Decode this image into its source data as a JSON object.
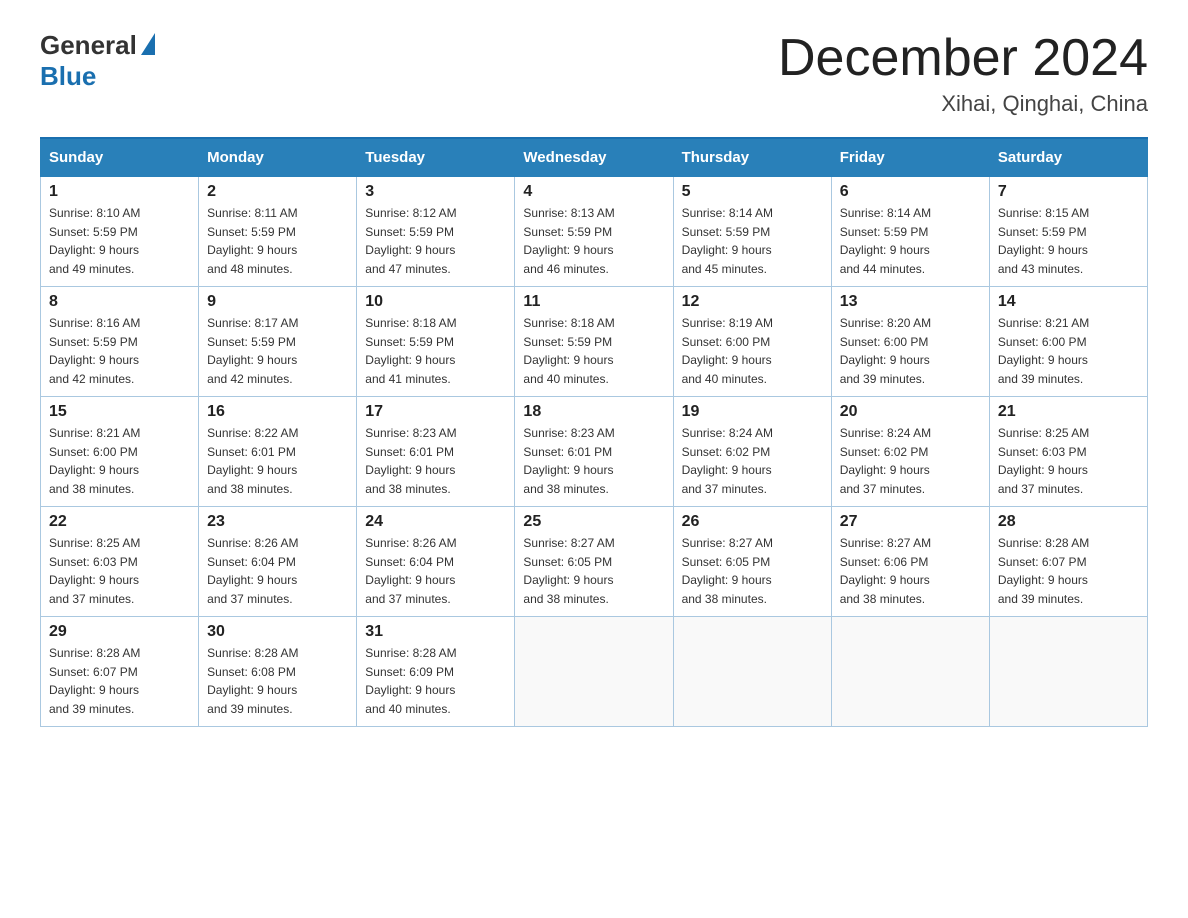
{
  "header": {
    "logo_general": "General",
    "logo_blue": "Blue",
    "title": "December 2024",
    "subtitle": "Xihai, Qinghai, China"
  },
  "days_of_week": [
    "Sunday",
    "Monday",
    "Tuesday",
    "Wednesday",
    "Thursday",
    "Friday",
    "Saturday"
  ],
  "weeks": [
    [
      {
        "day": "1",
        "sunrise": "8:10 AM",
        "sunset": "5:59 PM",
        "daylight": "9 hours and 49 minutes."
      },
      {
        "day": "2",
        "sunrise": "8:11 AM",
        "sunset": "5:59 PM",
        "daylight": "9 hours and 48 minutes."
      },
      {
        "day": "3",
        "sunrise": "8:12 AM",
        "sunset": "5:59 PM",
        "daylight": "9 hours and 47 minutes."
      },
      {
        "day": "4",
        "sunrise": "8:13 AM",
        "sunset": "5:59 PM",
        "daylight": "9 hours and 46 minutes."
      },
      {
        "day": "5",
        "sunrise": "8:14 AM",
        "sunset": "5:59 PM",
        "daylight": "9 hours and 45 minutes."
      },
      {
        "day": "6",
        "sunrise": "8:14 AM",
        "sunset": "5:59 PM",
        "daylight": "9 hours and 44 minutes."
      },
      {
        "day": "7",
        "sunrise": "8:15 AM",
        "sunset": "5:59 PM",
        "daylight": "9 hours and 43 minutes."
      }
    ],
    [
      {
        "day": "8",
        "sunrise": "8:16 AM",
        "sunset": "5:59 PM",
        "daylight": "9 hours and 42 minutes."
      },
      {
        "day": "9",
        "sunrise": "8:17 AM",
        "sunset": "5:59 PM",
        "daylight": "9 hours and 42 minutes."
      },
      {
        "day": "10",
        "sunrise": "8:18 AM",
        "sunset": "5:59 PM",
        "daylight": "9 hours and 41 minutes."
      },
      {
        "day": "11",
        "sunrise": "8:18 AM",
        "sunset": "5:59 PM",
        "daylight": "9 hours and 40 minutes."
      },
      {
        "day": "12",
        "sunrise": "8:19 AM",
        "sunset": "6:00 PM",
        "daylight": "9 hours and 40 minutes."
      },
      {
        "day": "13",
        "sunrise": "8:20 AM",
        "sunset": "6:00 PM",
        "daylight": "9 hours and 39 minutes."
      },
      {
        "day": "14",
        "sunrise": "8:21 AM",
        "sunset": "6:00 PM",
        "daylight": "9 hours and 39 minutes."
      }
    ],
    [
      {
        "day": "15",
        "sunrise": "8:21 AM",
        "sunset": "6:00 PM",
        "daylight": "9 hours and 38 minutes."
      },
      {
        "day": "16",
        "sunrise": "8:22 AM",
        "sunset": "6:01 PM",
        "daylight": "9 hours and 38 minutes."
      },
      {
        "day": "17",
        "sunrise": "8:23 AM",
        "sunset": "6:01 PM",
        "daylight": "9 hours and 38 minutes."
      },
      {
        "day": "18",
        "sunrise": "8:23 AM",
        "sunset": "6:01 PM",
        "daylight": "9 hours and 38 minutes."
      },
      {
        "day": "19",
        "sunrise": "8:24 AM",
        "sunset": "6:02 PM",
        "daylight": "9 hours and 37 minutes."
      },
      {
        "day": "20",
        "sunrise": "8:24 AM",
        "sunset": "6:02 PM",
        "daylight": "9 hours and 37 minutes."
      },
      {
        "day": "21",
        "sunrise": "8:25 AM",
        "sunset": "6:03 PM",
        "daylight": "9 hours and 37 minutes."
      }
    ],
    [
      {
        "day": "22",
        "sunrise": "8:25 AM",
        "sunset": "6:03 PM",
        "daylight": "9 hours and 37 minutes."
      },
      {
        "day": "23",
        "sunrise": "8:26 AM",
        "sunset": "6:04 PM",
        "daylight": "9 hours and 37 minutes."
      },
      {
        "day": "24",
        "sunrise": "8:26 AM",
        "sunset": "6:04 PM",
        "daylight": "9 hours and 37 minutes."
      },
      {
        "day": "25",
        "sunrise": "8:27 AM",
        "sunset": "6:05 PM",
        "daylight": "9 hours and 38 minutes."
      },
      {
        "day": "26",
        "sunrise": "8:27 AM",
        "sunset": "6:05 PM",
        "daylight": "9 hours and 38 minutes."
      },
      {
        "day": "27",
        "sunrise": "8:27 AM",
        "sunset": "6:06 PM",
        "daylight": "9 hours and 38 minutes."
      },
      {
        "day": "28",
        "sunrise": "8:28 AM",
        "sunset": "6:07 PM",
        "daylight": "9 hours and 39 minutes."
      }
    ],
    [
      {
        "day": "29",
        "sunrise": "8:28 AM",
        "sunset": "6:07 PM",
        "daylight": "9 hours and 39 minutes."
      },
      {
        "day": "30",
        "sunrise": "8:28 AM",
        "sunset": "6:08 PM",
        "daylight": "9 hours and 39 minutes."
      },
      {
        "day": "31",
        "sunrise": "8:28 AM",
        "sunset": "6:09 PM",
        "daylight": "9 hours and 40 minutes."
      },
      null,
      null,
      null,
      null
    ]
  ],
  "sunrise_label": "Sunrise:",
  "sunset_label": "Sunset:",
  "daylight_label": "Daylight:"
}
